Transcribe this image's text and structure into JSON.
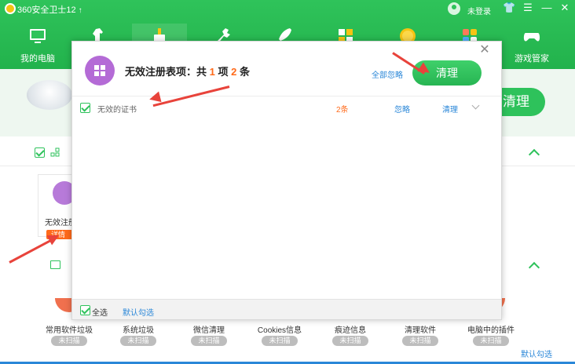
{
  "app": {
    "title": "360安全卫士12",
    "update_glyph": "↑",
    "login": "未登录",
    "window_controls": [
      {
        "name": "skin-icon",
        "glyph": "👕"
      },
      {
        "name": "menu-icon",
        "glyph": "☰"
      },
      {
        "name": "minimize-icon",
        "glyph": "—"
      },
      {
        "name": "close-icon",
        "glyph": "✕"
      }
    ]
  },
  "nav": {
    "items": [
      {
        "label": "我的电脑",
        "icon": "monitor-icon"
      },
      {
        "label": "",
        "icon": "trojan-horse-icon"
      },
      {
        "label": "",
        "icon": "broom-icon",
        "active": true
      },
      {
        "label": "",
        "icon": "wrench-icon"
      },
      {
        "label": "",
        "icon": "rocket-icon"
      },
      {
        "label": "",
        "icon": "blocks-icon"
      },
      {
        "label": "",
        "icon": "coin-icon"
      },
      {
        "label": "",
        "icon": "apps-icon"
      },
      {
        "label": "游戏管家",
        "icon": "gamepad-icon"
      }
    ]
  },
  "background": {
    "clean_button": "清理",
    "card_label": "无效注册",
    "card_badge": "详情",
    "tools": [
      {
        "label": "常用软件垃圾",
        "status": "未扫描"
      },
      {
        "label": "系统垃圾",
        "status": "未扫描"
      },
      {
        "label": "微信清理",
        "status": "未扫描"
      },
      {
        "label": "Cookies信息",
        "status": "未扫描"
      },
      {
        "label": "痕迹信息",
        "status": "未扫描"
      },
      {
        "label": "清理软件",
        "status": "未扫描"
      },
      {
        "label": "电脑中的插件",
        "status": "未扫描"
      }
    ],
    "default_select": "默认勾选"
  },
  "dialog": {
    "close": "✕",
    "title_prefix": "无效注册表项：共 ",
    "title_count1": "1",
    "title_mid": " 项 ",
    "title_count2": "2",
    "title_suffix": " 条",
    "ignore_all": "全部忽略",
    "clean_button": "清理",
    "items": [
      {
        "label": "无效的证书",
        "count": "2条",
        "ignore": "忽略",
        "clean": "清理",
        "checked": true
      }
    ],
    "footer": {
      "select_all": "全选",
      "default_check": "默认勾选"
    }
  },
  "colors": {
    "brand_green": "#2ec25b",
    "accent_orange": "#ff6a1a",
    "link_blue": "#2a87d8",
    "annotation_red": "#e8433b",
    "icon_purple": "#b46bd6"
  }
}
